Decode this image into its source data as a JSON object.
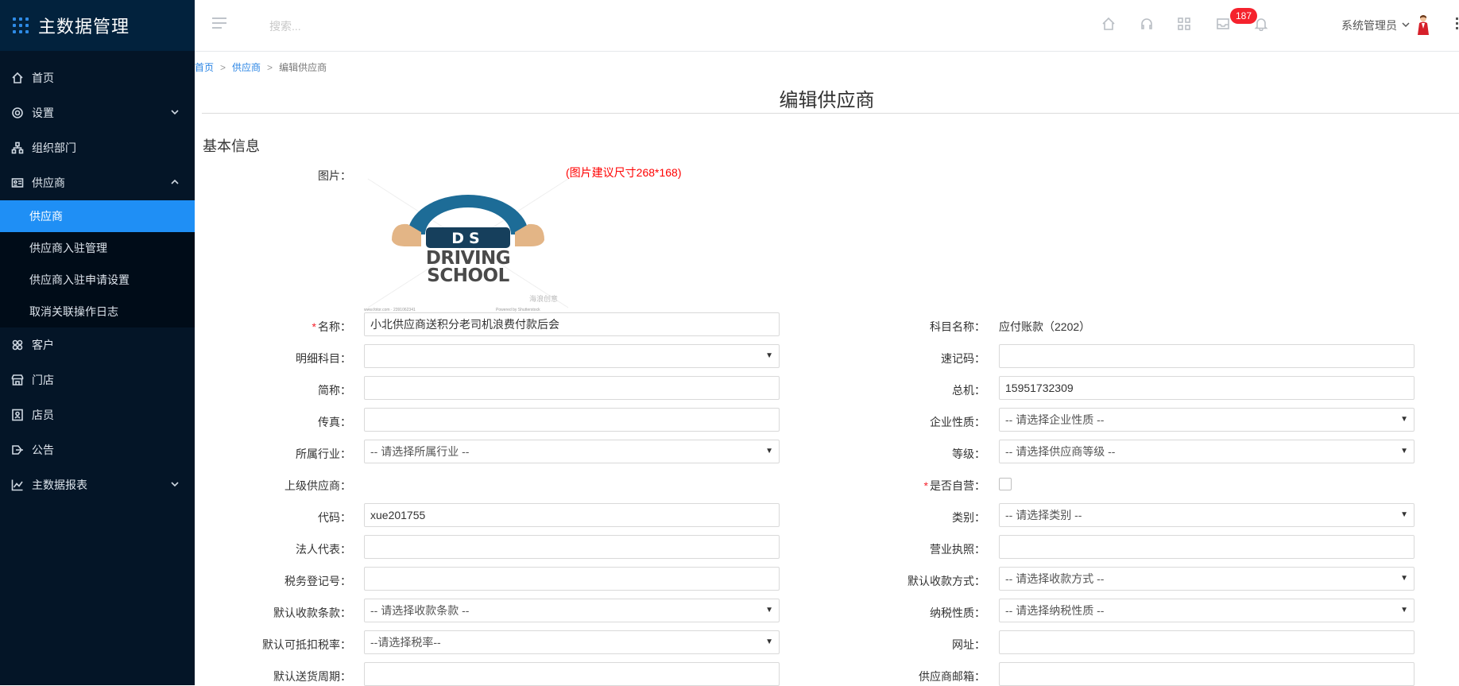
{
  "brand": {
    "title": "主数据管理"
  },
  "sidebar": {
    "items": [
      {
        "label": "首页"
      },
      {
        "label": "设置"
      },
      {
        "label": "组织部门"
      },
      {
        "label": "供应商"
      },
      {
        "label": "客户"
      },
      {
        "label": "门店"
      },
      {
        "label": "店员"
      },
      {
        "label": "公告"
      },
      {
        "label": "主数据报表"
      }
    ],
    "sub_items": [
      {
        "label": "供应商"
      },
      {
        "label": "供应商入驻管理"
      },
      {
        "label": "供应商入驻申请设置"
      },
      {
        "label": "取消关联操作日志"
      }
    ]
  },
  "topbar": {
    "search_placeholder": "搜索...",
    "badge_count": "187",
    "user_name": "系统管理员"
  },
  "breadcrumb": {
    "home": "首页",
    "parent": "供应商",
    "current": "编辑供应商"
  },
  "page": {
    "title": "编辑供应商",
    "section": "基本信息",
    "image_label": "图片：",
    "image_hint": "(图片建议尺寸268*168)"
  },
  "logo": {
    "line1": "DS",
    "line2": "DRIVING",
    "line3": "SCHOOL",
    "watermark_left": "www.fotor.com · 2391062341",
    "watermark_right": "Powered by Shutterstock",
    "stamp": "海浪创意"
  },
  "form": {
    "left": [
      {
        "label": "名称：",
        "required": true,
        "value": "小北供应商送积分老司机浪费付款后会"
      },
      {
        "label": "明细科目：",
        "value": ""
      },
      {
        "label": "简称：",
        "value": ""
      },
      {
        "label": "传真：",
        "value": ""
      },
      {
        "label": "所属行业：",
        "value": "-- 请选择所属行业 --"
      },
      {
        "label": "上级供应商：",
        "value": ""
      },
      {
        "label": "代码：",
        "value": "xue201755"
      },
      {
        "label": "法人代表：",
        "value": ""
      },
      {
        "label": "税务登记号：",
        "value": ""
      },
      {
        "label": "默认收款条款：",
        "value": "-- 请选择收款条款 --"
      },
      {
        "label": "默认可抵扣税率：",
        "value": "--请选择税率--"
      },
      {
        "label": "默认送货周期：",
        "value": ""
      }
    ],
    "right": [
      {
        "label": "科目名称：",
        "value": "应付账款（2202）"
      },
      {
        "label": "速记码：",
        "value": ""
      },
      {
        "label": "总机：",
        "value": "15951732309"
      },
      {
        "label": "企业性质：",
        "value": "-- 请选择企业性质 --"
      },
      {
        "label": "等级：",
        "value": "-- 请选择供应商等级 --"
      },
      {
        "label": "是否自营：",
        "required": true,
        "checked": false
      },
      {
        "label": "类别：",
        "value": "-- 请选择类别 --"
      },
      {
        "label": "营业执照：",
        "value": ""
      },
      {
        "label": "默认收款方式：",
        "value": "-- 请选择收款方式 --"
      },
      {
        "label": "纳税性质：",
        "value": "-- 请选择纳税性质 --"
      },
      {
        "label": "网址：",
        "value": ""
      },
      {
        "label": "供应商邮箱：",
        "value": ""
      }
    ]
  }
}
